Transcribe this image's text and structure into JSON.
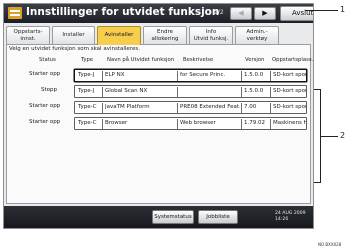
{
  "window": {
    "title": "Innstillinger for utvidet funksjon",
    "page_indicator": "1/2",
    "prev_icon": "◀",
    "next_icon": "▶",
    "exit_label": "Avslutt"
  },
  "tabs": [
    {
      "line1": "Oppstarts-",
      "line2": "innst.",
      "active": false
    },
    {
      "line1": "Installer",
      "line2": "",
      "active": false
    },
    {
      "line1": "Avinstaller",
      "line2": "",
      "active": true
    },
    {
      "line1": "Endre",
      "line2": "allokering",
      "active": false
    },
    {
      "line1": "Info",
      "line2": "Utvid funksj.",
      "active": false
    },
    {
      "line1": "Admin.-",
      "line2": "verktøy",
      "active": false
    }
  ],
  "instruction": "Velg en utvidet funksjon som skal avinstalleres.",
  "columns": {
    "status": "Status",
    "type": "Type",
    "name": "Navn på Utvidet funksjon",
    "description": "Beskrivelse",
    "version": "Versjon",
    "startup_place": "Oppstartsplass."
  },
  "rows": [
    {
      "status": "Starter opp",
      "type": "Type-J",
      "name": "ELP NX",
      "description": "for Secure Princ.",
      "version": "1.5.0.0",
      "startup_place": "SD-kort spor 2"
    },
    {
      "status": "Stopp",
      "type": "Type-J",
      "name": "Global Scan NX",
      "description": "",
      "version": "1.5.0.0",
      "startup_place": "SD-kort spor 2"
    },
    {
      "status": "Starter opp",
      "type": "Type-C",
      "name": "JavaTM Platform",
      "description": "PRE08 Extended Feat...",
      "version": "7.00",
      "startup_place": "SD-kort spor 2"
    },
    {
      "status": "Starter opp",
      "type": "Type-C",
      "name": "Browser",
      "description": "Web browser",
      "version": "1.79.02",
      "startup_place": "Maskinens HD"
    }
  ],
  "footer": {
    "system_status": "Systemstatus",
    "job_list": "Jobbliste",
    "date": "24 AUG 2009",
    "time": "14:26"
  },
  "callouts": {
    "one": "1",
    "two": "2"
  },
  "figure_code": "NO BXX028"
}
